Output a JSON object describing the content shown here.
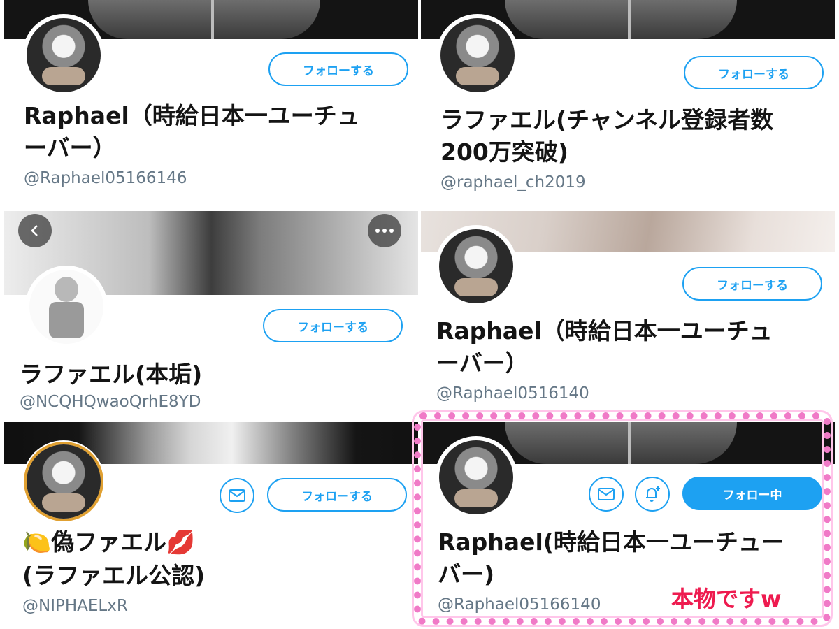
{
  "colors": {
    "twitter_blue": "#1da1f2",
    "note_red": "#ee1b4f",
    "frame_pink": "#f07ac7"
  },
  "profiles": [
    {
      "follow_label": "フォローする",
      "name": "Raphael（時給日本一ユーチュ",
      "name2": "ーバー）",
      "handle": "@Raphael05166146"
    },
    {
      "follow_label": "フォローする",
      "name": "ラファエル(チャンネル登録者数",
      "name2": "200万突破)",
      "handle": "@raphael_ch2019"
    },
    {
      "follow_label": "フォローする",
      "name": "ラファエル(本垢)",
      "handle": "@NCQHQwaoQrhE8YD"
    },
    {
      "follow_label": "フォローする",
      "name": "Raphael（時給日本一ユーチュ",
      "name2": "ーバー）",
      "handle": "@Raphael0516140"
    },
    {
      "follow_label": "フォローする",
      "name": "🍋偽ファエル💋",
      "name2": "(ラファエル公認)",
      "handle": "@NIPHAELxR"
    },
    {
      "follow_label": "フォロー中",
      "name": "Raphael(時給日本一ユーチュー",
      "name2": "バー)",
      "handle": "@Raphael05166140"
    }
  ],
  "note": "本物ですw",
  "icons": [
    "back-chevron-icon",
    "more-dots-icon",
    "mail-icon",
    "bell-plus-icon"
  ]
}
